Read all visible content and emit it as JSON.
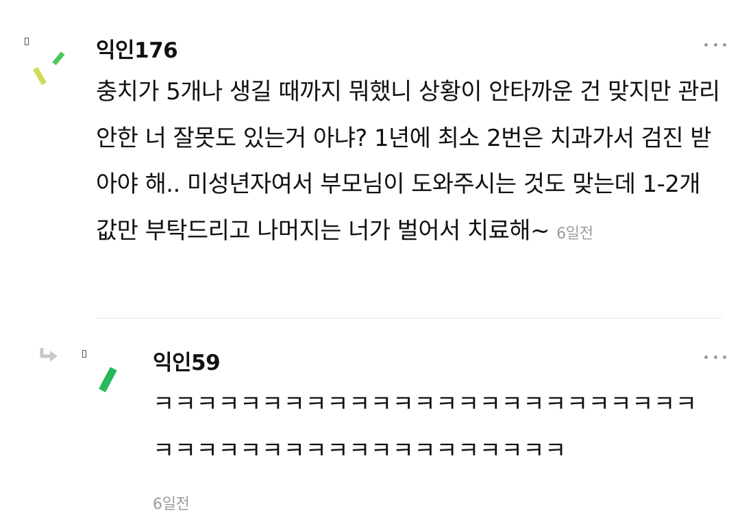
{
  "comments": [
    {
      "author": "익인176",
      "text": "충치가 5개나 생길 때까지 뭐했니 상황이 안타까운 건 맞지만 관리 안한 너 잘못도 있는거 아냐? 1년에 최소 2번은 치과가서 검진 받아야 해.. 미성년자여서 부모님이 도와주시는 것도 맞는데 1-2개 값만 부탁드리고 나머지는 너가 벌어서 치료해~",
      "time": "6일전",
      "avatar_icon": "confetti-avatar-icon",
      "accent_colors": [
        "#c9d84a",
        "#4cc55a"
      ]
    },
    {
      "author": "익인59",
      "text": "ㅋㅋㅋㅋㅋㅋㅋㅋㅋㅋㅋㅋㅋㅋㅋㅋㅋㅋㅋㅋㅋㅋㅋㅋㅋㅋㅋㅋㅋㅋㅋㅋㅋㅋㅋㅋㅋㅋㅋㅋㅋㅋㅋㅋ",
      "time": "6일전",
      "is_reply": true,
      "reply_icon": "reply-arrow-icon",
      "avatar_icon": "confetti-avatar-icon",
      "accent_colors": [
        "#27b85a"
      ]
    }
  ],
  "more_icon": "more-dots-icon"
}
